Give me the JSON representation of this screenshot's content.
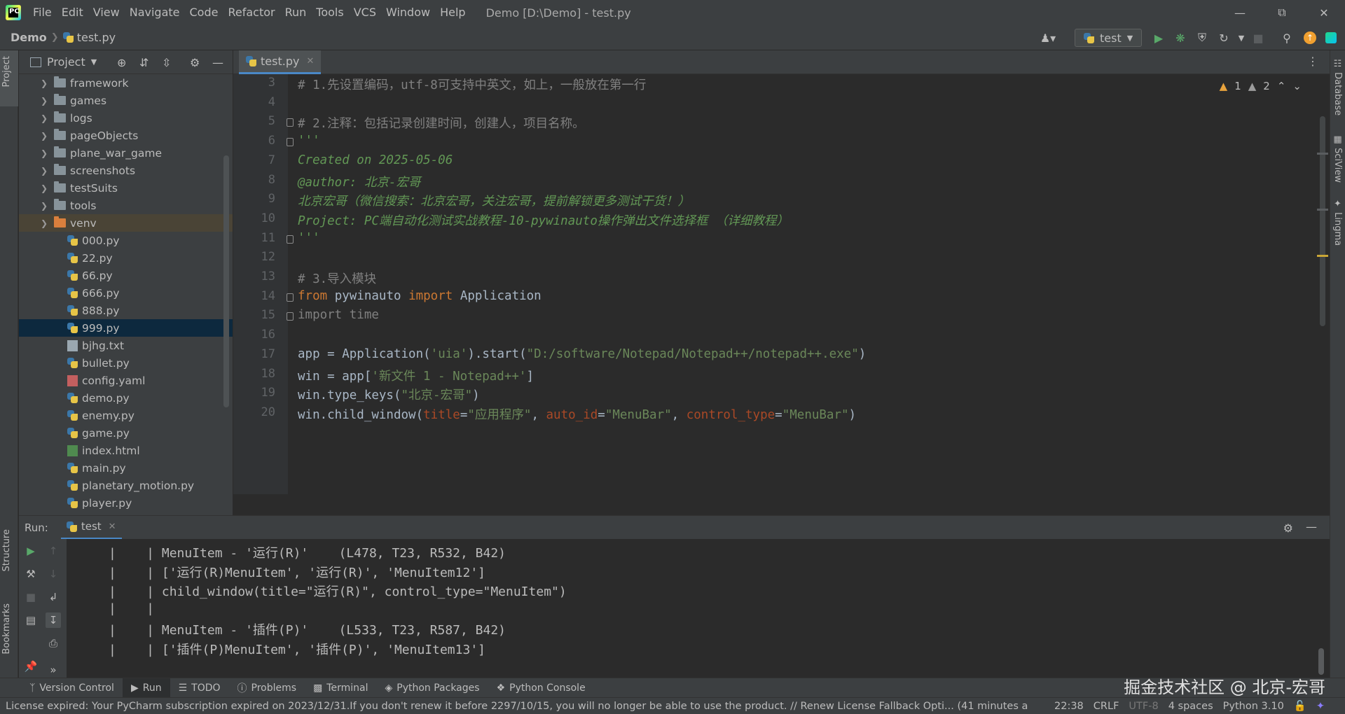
{
  "titlebar": {
    "menu": [
      "File",
      "Edit",
      "View",
      "Navigate",
      "Code",
      "Refactor",
      "Run",
      "Tools",
      "VCS",
      "Window",
      "Help"
    ],
    "window_title": "Demo [D:\\Demo] - test.py"
  },
  "navbar": {
    "project": "Demo",
    "file": "test.py",
    "run_config": "test"
  },
  "project_panel": {
    "title": "Project",
    "tree": [
      {
        "name": "framework",
        "type": "folder"
      },
      {
        "name": "games",
        "type": "folder"
      },
      {
        "name": "logs",
        "type": "folder"
      },
      {
        "name": "pageObjects",
        "type": "folder"
      },
      {
        "name": "plane_war_game",
        "type": "folder"
      },
      {
        "name": "screenshots",
        "type": "folder"
      },
      {
        "name": "testSuits",
        "type": "folder"
      },
      {
        "name": "tools",
        "type": "folder"
      },
      {
        "name": "venv",
        "type": "folder-excluded"
      },
      {
        "name": "000.py",
        "type": "py"
      },
      {
        "name": "22.py",
        "type": "py"
      },
      {
        "name": "66.py",
        "type": "py"
      },
      {
        "name": "666.py",
        "type": "py"
      },
      {
        "name": "888.py",
        "type": "py"
      },
      {
        "name": "999.py",
        "type": "py",
        "selected": true
      },
      {
        "name": "bjhg.txt",
        "type": "txt"
      },
      {
        "name": "bullet.py",
        "type": "py"
      },
      {
        "name": "config.yaml",
        "type": "yml"
      },
      {
        "name": "demo.py",
        "type": "py"
      },
      {
        "name": "enemy.py",
        "type": "py"
      },
      {
        "name": "game.py",
        "type": "py"
      },
      {
        "name": "index.html",
        "type": "html"
      },
      {
        "name": "main.py",
        "type": "py"
      },
      {
        "name": "planetary_motion.py",
        "type": "py"
      },
      {
        "name": "player.py",
        "type": "py"
      }
    ]
  },
  "editor": {
    "tab": "test.py",
    "inspection": {
      "warnings": "1",
      "weak_warnings": "2"
    },
    "lines": [
      {
        "n": "3",
        "tokens": [
          [
            "c-comment",
            "# 1.先设置编码，utf-8可支持中英文，如上，一般放在第一行"
          ]
        ]
      },
      {
        "n": "4",
        "tokens": []
      },
      {
        "n": "5",
        "tokens": [
          [
            "c-comment",
            "# 2.注释：包括记录创建时间，创建人，项目名称。"
          ]
        ],
        "fold": true
      },
      {
        "n": "6",
        "tokens": [
          [
            "c-doc",
            "'''"
          ]
        ],
        "fold": true
      },
      {
        "n": "7",
        "tokens": [
          [
            "c-doc",
            "Created on 2025-05-06"
          ]
        ]
      },
      {
        "n": "8",
        "tokens": [
          [
            "c-doc",
            "@author: 北京-宏哥"
          ]
        ]
      },
      {
        "n": "9",
        "tokens": [
          [
            "c-doc",
            "北京宏哥（微信搜索：北京宏哥，关注宏哥，提前解锁更多测试干货！）"
          ]
        ]
      },
      {
        "n": "10",
        "tokens": [
          [
            "c-doc",
            "Project: PC端自动化测试实战教程-10-pywinauto操作弹出文件选择框 （详细教程）"
          ]
        ]
      },
      {
        "n": "11",
        "tokens": [
          [
            "c-doc",
            "'''"
          ]
        ],
        "fold": true
      },
      {
        "n": "12",
        "tokens": []
      },
      {
        "n": "13",
        "tokens": [
          [
            "c-comment",
            "# 3.导入模块"
          ]
        ]
      },
      {
        "n": "14",
        "tokens": [
          [
            "c-kw",
            "from"
          ],
          [
            "",
            " pywinauto "
          ],
          [
            "c-kw",
            "import"
          ],
          [
            "",
            " Application"
          ]
        ],
        "fold": true
      },
      {
        "n": "15",
        "tokens": [
          [
            "c-comment",
            "import time"
          ]
        ],
        "fold": true
      },
      {
        "n": "16",
        "tokens": []
      },
      {
        "n": "17",
        "tokens": [
          [
            "",
            "app = Application("
          ],
          [
            "c-str",
            "'uia'"
          ],
          [
            "",
            ").start("
          ],
          [
            "c-str",
            "\"D:/software/Notepad/Notepad++/notepad++.exe\""
          ],
          [
            "",
            ")"
          ]
        ]
      },
      {
        "n": "18",
        "tokens": [
          [
            "",
            "win = app["
          ],
          [
            "c-str",
            "'新文件 1 - Notepad++'"
          ],
          [
            "",
            "]"
          ]
        ]
      },
      {
        "n": "19",
        "tokens": [
          [
            "",
            "win.type_keys("
          ],
          [
            "c-str",
            "\"北京-宏哥\""
          ],
          [
            "",
            ")"
          ]
        ]
      },
      {
        "n": "20",
        "tokens": [
          [
            "",
            "win.child_window("
          ],
          [
            "c-param",
            "title"
          ],
          [
            "",
            "="
          ],
          [
            "c-str",
            "\"应用程序\""
          ],
          [
            "",
            ", "
          ],
          [
            "c-param",
            "auto_id"
          ],
          [
            "",
            "="
          ],
          [
            "c-str",
            "\"MenuBar\""
          ],
          [
            "",
            ", "
          ],
          [
            "c-param",
            "control_type"
          ],
          [
            "",
            "="
          ],
          [
            "c-str",
            "\"MenuBar\""
          ],
          [
            "",
            ")"
          ]
        ]
      }
    ]
  },
  "run_panel": {
    "label": "Run:",
    "tab": "test",
    "output": [
      "|    | MenuItem - '运行(R)'    (L478, T23, R532, B42)",
      "|    | ['运行(R)MenuItem', '运行(R)', 'MenuItem12']",
      "|    | child_window(title=\"运行(R)\", control_type=\"MenuItem\")",
      "|    |",
      "|    | MenuItem - '插件(P)'    (L533, T23, R587, B42)",
      "|    | ['插件(P)MenuItem', '插件(P)', 'MenuItem13']"
    ]
  },
  "left_strip": {
    "project": "Project",
    "structure": "Structure",
    "bookmarks": "Bookmarks"
  },
  "right_strip": {
    "database": "Database",
    "sciview": "SciView",
    "lingma": "Lingma"
  },
  "bottom_tabs": [
    "Version Control",
    "Run",
    "TODO",
    "Problems",
    "Terminal",
    "Python Packages",
    "Python Console"
  ],
  "watermark": "掘金技术社区 @ 北京-宏哥",
  "statusbar": {
    "message": "License expired: Your PyCharm subscription expired on 2023/12/31.If you don't renew it before 2297/10/15, you will no longer be able to use the product. // Renew License   Fallback Opti... (41 minutes a",
    "position": "22:38",
    "line_sep": "CRLF",
    "encoding": "UTF-8",
    "indent": "4 spaces",
    "interpreter": "Python 3.10"
  }
}
